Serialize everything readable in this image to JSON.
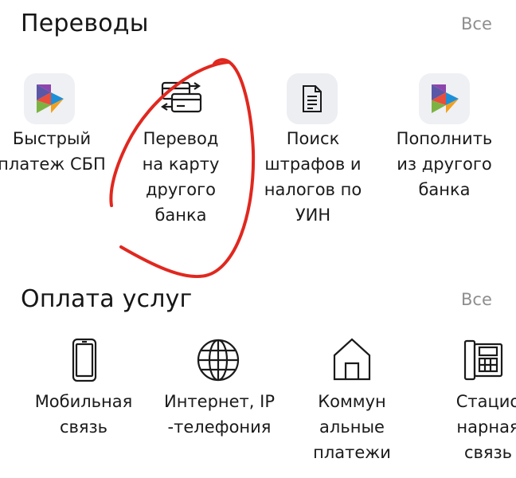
{
  "transfers": {
    "title": "Переводы",
    "all_label": "Все",
    "items": [
      {
        "label": "Быстрый\nплатеж СБП",
        "icon": "sbp-logo-icon"
      },
      {
        "label": "Перевод\nна карту\nдругого\nбанка",
        "icon": "card-transfer-icon"
      },
      {
        "label": "Поиск\nштрафов и\nналогов по\nУИН",
        "icon": "document-icon"
      },
      {
        "label": "Пополнить\nиз другого\nбанка",
        "icon": "sbp-logo-icon"
      }
    ]
  },
  "services": {
    "title": "Оплата услуг",
    "all_label": "Все",
    "items": [
      {
        "label": "Мобильная\nсвязь",
        "icon": "mobile-phone-icon"
      },
      {
        "label": "Интернет, IP\n-телефония",
        "icon": "globe-icon"
      },
      {
        "label": "Коммун\nальные\nплатежи",
        "icon": "house-icon"
      },
      {
        "label": "Стацио\nнарная\nсвязь",
        "icon": "landline-phone-icon"
      }
    ]
  },
  "colors": {
    "annotation_circle": "#e0281f",
    "muted_text": "#8e8e8e",
    "tile_background": "#eceef2"
  }
}
